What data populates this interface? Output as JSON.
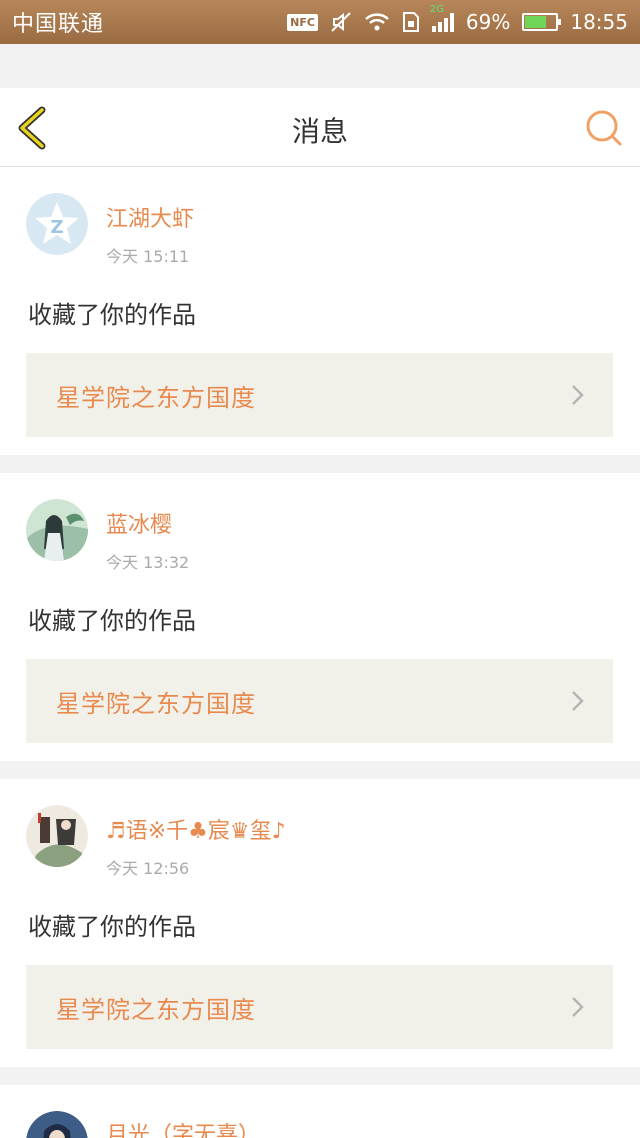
{
  "status_bar": {
    "carrier": "中国联通",
    "nfc": "NFC",
    "network": "2G",
    "battery": "69%",
    "battery_level": 0.69,
    "time": "18:55"
  },
  "nav": {
    "title": "消息",
    "back_icon": "chevron-left-icon",
    "search_icon": "search-icon",
    "accent": "#e88a4f"
  },
  "messages": [
    {
      "name": "江湖大虾",
      "time": "今天 15:11",
      "action": "收藏了你的作品",
      "work": "星学院之东方国度"
    },
    {
      "name": "蓝冰樱",
      "time": "今天 13:32",
      "action": "收藏了你的作品",
      "work": "星学院之东方国度"
    },
    {
      "name": "♬语※千♣宸♛玺♪",
      "time": "今天 12:56",
      "action": "收藏了你的作品",
      "work": "星学院之东方国度"
    },
    {
      "name": "月光（字无喜）",
      "time": "",
      "action": "",
      "work": ""
    }
  ]
}
